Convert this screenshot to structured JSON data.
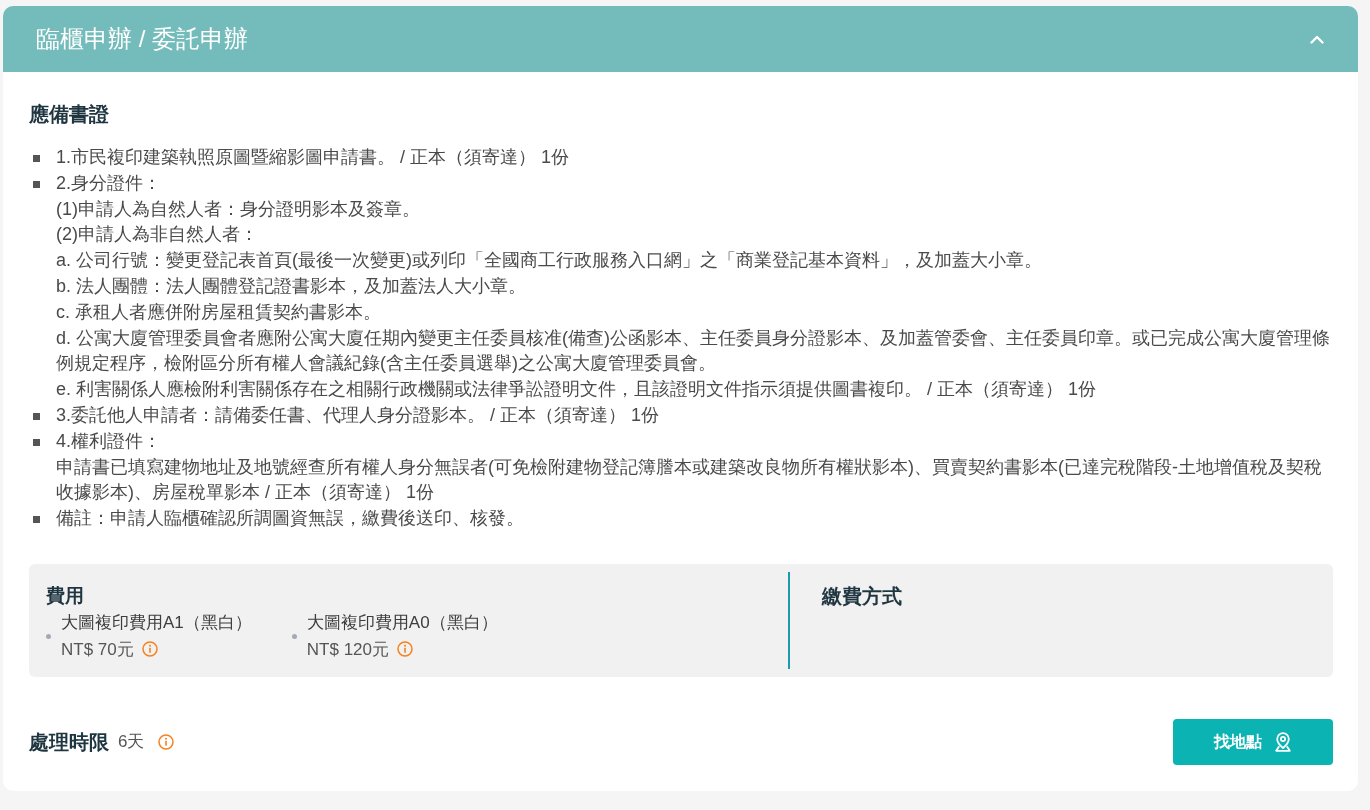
{
  "panel": {
    "title": "臨櫃申辦 / 委託申辦",
    "expanded": true
  },
  "documents": {
    "heading": "應備書證",
    "items": [
      {
        "lines": [
          "1.市民複印建築執照原圖暨縮影圖申請書。 / 正本（須寄達） 1份"
        ]
      },
      {
        "lines": [
          "2.身分證件：",
          "(1)申請人為自然人者：身分證明影本及簽章。",
          "(2)申請人為非自然人者：",
          "a. 公司行號：變更登記表首頁(最後一次變更)或列印「全國商工行政服務入口網」之「商業登記基本資料」，及加蓋大小章。",
          "b. 法人團體：法人團體登記證書影本，及加蓋法人大小章。",
          "c. 承租人者應併附房屋租賃契約書影本。",
          "d. 公寓大廈管理委員會者應附公寓大廈任期內變更主任委員核准(備查)公函影本、主任委員身分證影本、及加蓋管委會、主任委員印章。或已完成公寓大廈管理條例規定程序，檢附區分所有權人會議紀錄(含主任委員選舉)之公寓大廈管理委員會。",
          "e. 利害關係人應檢附利害關係存在之相關行政機關或法律爭訟證明文件，且該證明文件指示須提供圖書複印。 / 正本（須寄達） 1份"
        ]
      },
      {
        "lines": [
          "3.委託他人申請者：請備委任書、代理人身分證影本。 / 正本（須寄達） 1份"
        ]
      },
      {
        "lines": [
          "4.權利證件：",
          "申請書已填寫建物地址及地號經查所有權人身分無誤者(可免檢附建物登記簿謄本或建築改良物所有權狀影本)、買賣契約書影本(已達完稅階段-土地增值稅及契稅收據影本)、房屋稅單影本 / 正本（須寄達） 1份"
        ]
      },
      {
        "lines": [
          "備註：申請人臨櫃確認所調圖資無誤，繳費後送印、核發。"
        ]
      }
    ]
  },
  "fees": {
    "heading": "費用",
    "items": [
      {
        "name": "大圖複印費用A1（黑白）",
        "price": "NT$ 70元"
      },
      {
        "name": "大圖複印費用A0（黑白）",
        "price": "NT$ 120元"
      }
    ]
  },
  "payment": {
    "heading": "繳費方式"
  },
  "processing": {
    "label": "處理時限",
    "value": "6天"
  },
  "button": {
    "label": "找地點"
  }
}
